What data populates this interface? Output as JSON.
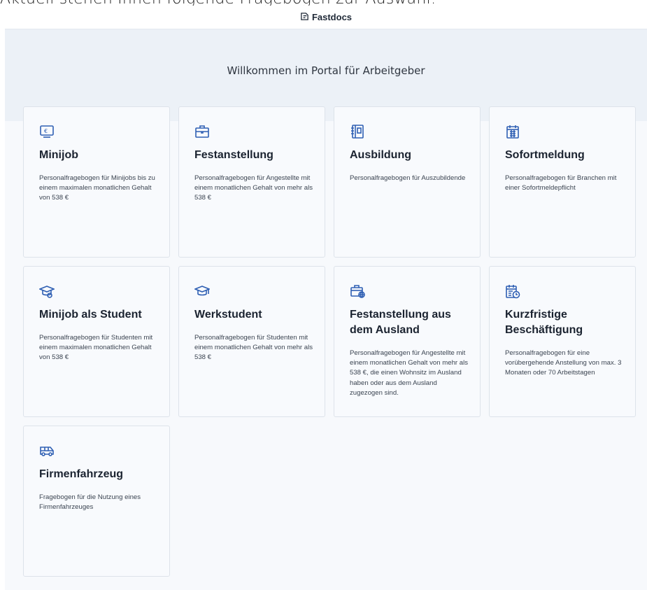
{
  "caption": "Aktuell stehen Ihnen folgende Fragebogen zur Auswahl:",
  "header": {
    "brand": "Fastdocs",
    "logo_icon": "fastdocs-logo-icon"
  },
  "hero": {
    "welcome": "Willkommen im Portal für Arbeitgeber"
  },
  "colors": {
    "icon": "#2f5fb3",
    "hero_bg": "#ecf1f7",
    "card_bg": "#f8fafd"
  },
  "cards": [
    {
      "title": "Minijob",
      "desc": "Personalfragebogen für Minijobs bis zu einem maximalen monatlichen Gehalt von 538 €",
      "icon": "money-icon"
    },
    {
      "title": "Festanstellung",
      "desc": "Personalfragebogen für Angestellte mit einem monatlichen Gehalt von mehr als 538 €",
      "icon": "briefcase-icon"
    },
    {
      "title": "Ausbildung",
      "desc": "Personalfragebogen für Auszubildende",
      "icon": "notebook-icon"
    },
    {
      "title": "Sofortmeldung",
      "desc": "Personalfragebogen für Branchen mit einer Sofortmeldepflicht",
      "icon": "calendar-icon"
    },
    {
      "title": "Minijob als Student",
      "desc": "Personalfragebogen für Studenten mit einem maximalen monatlichen Gehalt von 538 €",
      "icon": "graduation-cap-money-icon"
    },
    {
      "title": "Werkstudent",
      "desc": "Personalfragebogen für Studenten mit einem monatlichen Gehalt von mehr als 538 €",
      "icon": "graduation-cap-icon"
    },
    {
      "title": "Festanstellung aus dem Ausland",
      "desc": "Personalfragebogen für Angestellte mit einem monatlichen Gehalt von mehr als 538 €, die einen Wohnsitz im Ausland haben oder aus dem Ausland zugezogen sind.",
      "icon": "briefcase-globe-icon"
    },
    {
      "title": "Kurzfristige Beschäftigung",
      "desc": "Personalfragebogen für eine vorübergehende Anstellung von max. 3 Monaten oder 70 Arbeitstagen",
      "icon": "calendar-clock-icon"
    },
    {
      "title": "Firmenfahrzeug",
      "desc": "Fragebogen für die Nutzung eines Firmenfahrzeuges",
      "icon": "van-icon"
    }
  ]
}
